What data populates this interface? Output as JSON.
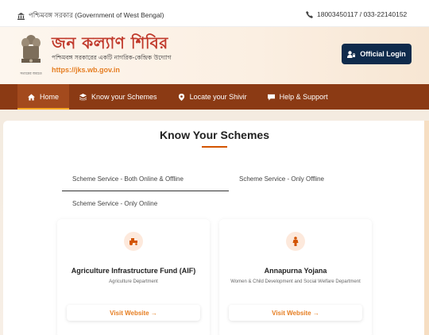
{
  "topbar": {
    "govt_text": "পশ্চিমবঙ্গ সরকার (Government of West Bengal)",
    "phone_text": "18003450117 / 033-22140152"
  },
  "header": {
    "emblem_caption": "সত্যমেব জয়তে",
    "title": "জন কল্যাণ শিবির",
    "subtitle": "পশ্চিমবঙ্গ সরকারের একটি নাগরিক-কেন্দ্রিক উদ্যোগ",
    "url": "https://jks.wb.gov.in",
    "login_label": "Official Login"
  },
  "nav": {
    "items": [
      {
        "label": "Home",
        "icon": "home-icon"
      },
      {
        "label": "Know your Schemes",
        "icon": "layers-icon"
      },
      {
        "label": "Locate your Shivir",
        "icon": "map-pin-icon"
      },
      {
        "label": "Help & Support",
        "icon": "help-icon"
      }
    ]
  },
  "main": {
    "title": "Know Your Schemes",
    "tabs": [
      {
        "label": "Scheme Service - Both Online & Offline"
      },
      {
        "label": "Scheme Service - Only Offline"
      },
      {
        "label": "Scheme Service - Only Online"
      }
    ],
    "cards": [
      {
        "title": "Agriculture Infrastructure Fund (AIF)",
        "department": "Agriculture Department",
        "button": "Visit Website →",
        "icon": "tractor-icon"
      },
      {
        "title": "Annapurna Yojana",
        "department": "Women & Child Development and Social Welfare Department",
        "button": "Visit Website →",
        "icon": "person-icon"
      }
    ]
  },
  "colors": {
    "nav_bg": "#8b3a14",
    "title_red": "#c0392b",
    "accent_orange": "#e67e22",
    "login_bg": "#0f2b4c"
  }
}
